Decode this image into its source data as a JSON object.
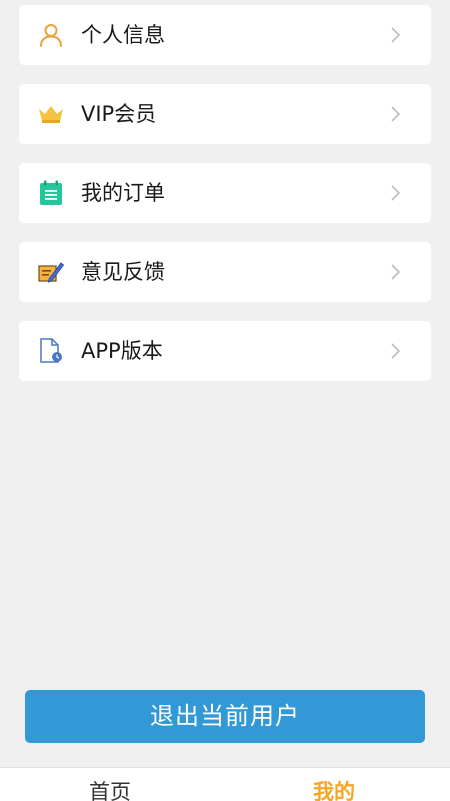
{
  "menu": {
    "items": [
      {
        "label": "个人信息",
        "icon": "user-icon"
      },
      {
        "label": "VIP会员",
        "icon": "crown-icon"
      },
      {
        "label": "我的订单",
        "icon": "order-icon"
      },
      {
        "label": "意见反馈",
        "icon": "feedback-icon"
      },
      {
        "label": "APP版本",
        "icon": "version-icon"
      }
    ]
  },
  "logout": {
    "label": "退出当前用户"
  },
  "tabbar": {
    "tabs": [
      {
        "label": "首页",
        "active": false
      },
      {
        "label": "我的",
        "active": true
      }
    ],
    "active_color": "#f5a623"
  },
  "colors": {
    "primary": "#3399d6",
    "background": "#f0f0f0"
  }
}
